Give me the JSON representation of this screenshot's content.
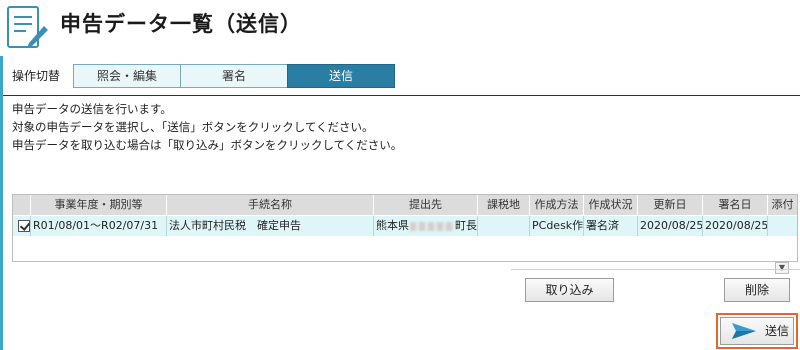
{
  "header": {
    "title": "申告データ一覧（送信）"
  },
  "mode": {
    "label": "操作切替",
    "tabs": [
      "照会・編集",
      "署名",
      "送信"
    ],
    "active": 2
  },
  "description": [
    "申告データの送信を行います。",
    "対象の申告データを選択し、「送信」ボタンをクリックしてください。",
    "申告データを取り込む場合は「取り込み」ボタンをクリックしてください。"
  ],
  "table": {
    "columns": [
      "事業年度・期別等",
      "手続名称",
      "提出先",
      "課税地",
      "作成方法",
      "作成状況",
      "更新日",
      "署名日",
      "添付"
    ],
    "rows": [
      {
        "checked": true,
        "period": "R01/08/01～R02/07/31",
        "procedure": "法人市町村民税　確定申告",
        "destination_prefix": "熊本県",
        "destination_suffix": "町長",
        "tax_place": "",
        "method": "PCdesk作成",
        "status": "署名済",
        "updated": "2020/08/25",
        "signed": "2020/08/25",
        "attach": ""
      }
    ]
  },
  "buttons": {
    "import": "取り込み",
    "delete": "削除",
    "send": "送信"
  },
  "colors": {
    "accent": "#2a7ea3",
    "highlight": "#e2672b",
    "row": "#dff6f8"
  }
}
